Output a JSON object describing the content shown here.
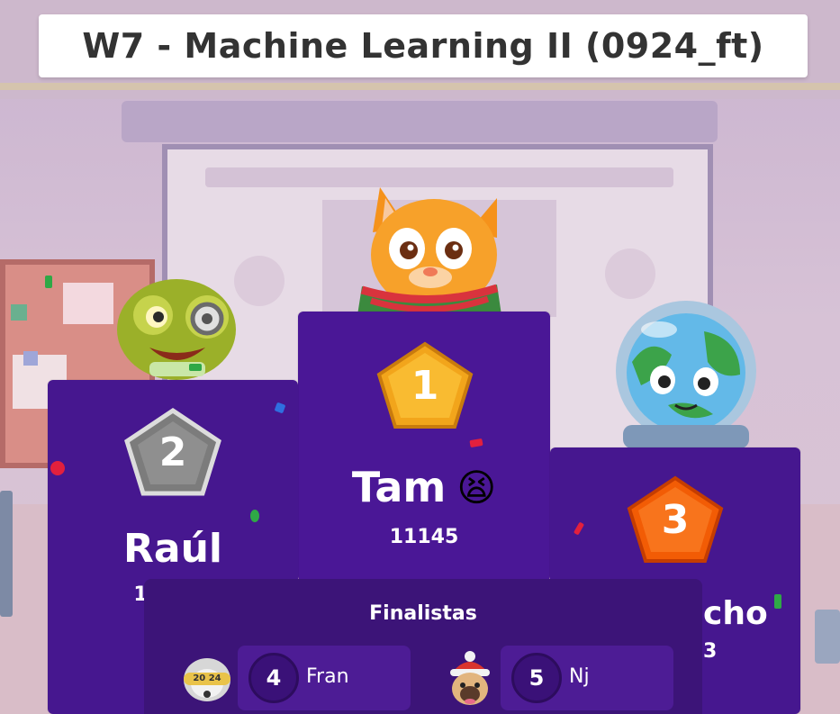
{
  "title": "W7 - Machine Learning II (0924_ft)",
  "podium": [
    {
      "rank": "2",
      "name": "Raúl",
      "score_visible": "1",
      "medal_color": "#8a8a8a"
    },
    {
      "rank": "1",
      "name": "Tam",
      "emoji": "😫",
      "score": "11145",
      "medal_color": "#f2a51b"
    },
    {
      "rank": "3",
      "name_visible": "cho",
      "score_visible": "3",
      "medal_color": "#f25c05"
    }
  ],
  "finalists": {
    "title": "Finalistas",
    "items": [
      {
        "rank": "4",
        "name": "Fran",
        "avatar": "year-badge-avatar",
        "avatar_text": "20 24"
      },
      {
        "rank": "5",
        "name": "Nj",
        "avatar": "pug-winter-hat-avatar"
      }
    ]
  },
  "colors": {
    "podium": "#46178f",
    "finalists_panel": "#3c1478",
    "accent": "#ffffff"
  }
}
